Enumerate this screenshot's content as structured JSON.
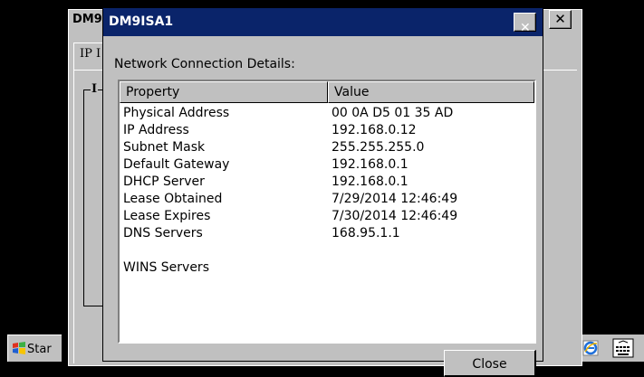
{
  "background_window": {
    "title": "DM9",
    "tab_label": "IP I",
    "group_label": "I"
  },
  "dialog": {
    "title": "DM9ISA1",
    "close_icon": "close-icon",
    "heading": "Network Connection Details:",
    "columns": [
      "Property",
      "Value"
    ],
    "rows": [
      {
        "property": "Physical Address",
        "value": "00 0A D5 01 35 AD"
      },
      {
        "property": "IP Address",
        "value": "192.168.0.12"
      },
      {
        "property": "Subnet Mask",
        "value": "255.255.255.0"
      },
      {
        "property": "Default Gateway",
        "value": "192.168.0.1"
      },
      {
        "property": "DHCP Server",
        "value": "192.168.0.1"
      },
      {
        "property": "Lease Obtained",
        "value": "7/29/2014 12:46:49"
      },
      {
        "property": "Lease Expires",
        "value": "7/30/2014 12:46:49"
      },
      {
        "property": "DNS Servers",
        "value": "168.95.1.1"
      },
      {
        "property": "",
        "value": ""
      },
      {
        "property": "WINS Servers",
        "value": ""
      }
    ],
    "close_button_label": "Close"
  },
  "taskbar": {
    "start_label": "Star",
    "tray_icons": [
      "ie-icon",
      "keyboard-icon"
    ]
  },
  "colors": {
    "titlebar": "#0a246a",
    "face": "#c0c0c0",
    "desktop": "#000000"
  }
}
